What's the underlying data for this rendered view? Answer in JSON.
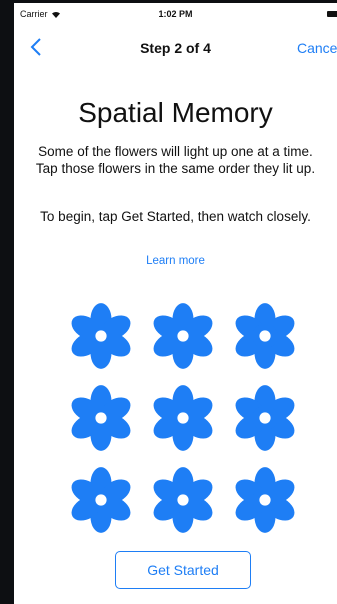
{
  "status_bar": {
    "carrier": "Carrier",
    "time": "1:02 PM",
    "wifi_icon": "wifi-icon",
    "battery_icon": "battery-icon"
  },
  "nav": {
    "back_icon": "chevron-left-icon",
    "title": "Step 2 of 4",
    "cancel_label": "Cancel"
  },
  "content": {
    "title": "Spatial Memory",
    "description_1": "Some of the flowers will light up one at a time. Tap those flowers in the same order they lit up.",
    "description_2": "To begin, tap Get Started, then watch closely.",
    "learn_more": "Learn more"
  },
  "grid": {
    "rows": 3,
    "columns": 3,
    "flower_icon": "flower-icon",
    "flower_color": "#1e7ef5"
  },
  "footer": {
    "get_started_label": "Get Started"
  },
  "colors": {
    "accent": "#1e7ef5",
    "background": "#ffffff",
    "text": "#111111"
  }
}
